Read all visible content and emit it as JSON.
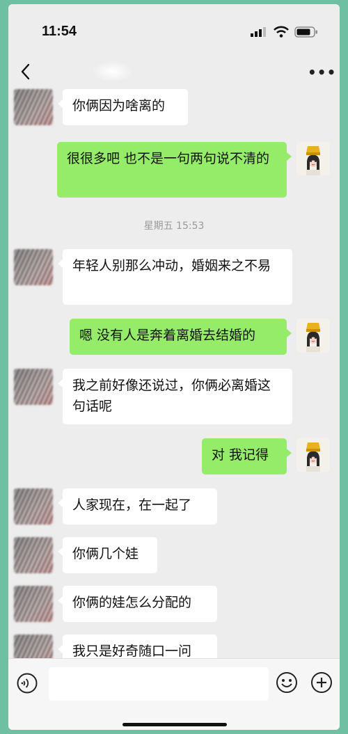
{
  "status": {
    "time": "11:54"
  },
  "nav": {
    "back_icon": "chevron-left-icon",
    "more_label": "•••"
  },
  "messages": [
    {
      "side": "in",
      "text": "你俩因为啥离的"
    },
    {
      "side": "out",
      "text": "很很多吧 也不是一句两句说不清的"
    },
    {
      "side": "timestamp",
      "text": "星期五 15:53"
    },
    {
      "side": "in",
      "text": "年轻人别那么冲动，婚姻来之不易"
    },
    {
      "side": "out",
      "text": "嗯 没有人是奔着离婚去结婚的"
    },
    {
      "side": "in",
      "text": "我之前好像还说过，你俩必离婚这句话呢"
    },
    {
      "side": "out",
      "text": "对 我记得"
    },
    {
      "side": "in",
      "text": "人家现在，在一起了"
    },
    {
      "side": "in",
      "text": "你俩几个娃"
    },
    {
      "side": "in",
      "text": "你俩的娃怎么分配的"
    },
    {
      "side": "in",
      "text": "我只是好奇随口一问"
    }
  ],
  "input": {
    "placeholder": "",
    "voice_icon": "voice-icon",
    "emoji_icon": "emoji-icon",
    "plus_icon": "plus-icon"
  },
  "colors": {
    "background": "#ededed",
    "outgoing_bubble": "#95ec69",
    "incoming_bubble": "#ffffff",
    "frame": "#6fbfa3"
  }
}
